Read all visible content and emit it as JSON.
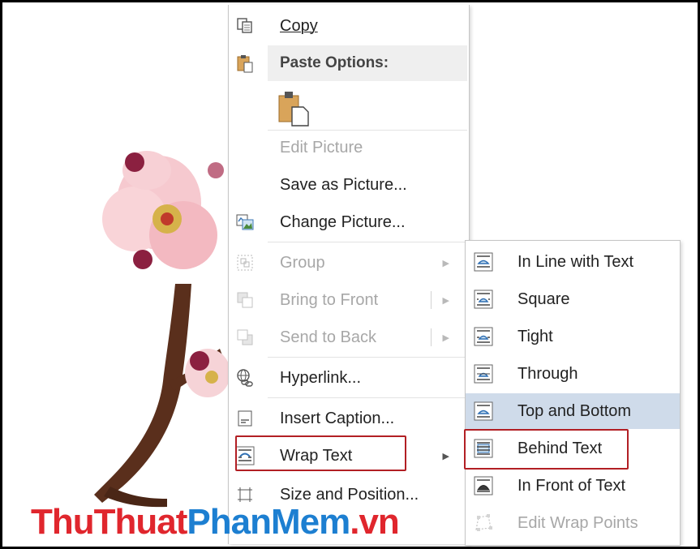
{
  "context_menu": {
    "items": [
      {
        "label": "Copy",
        "icon": "copy-icon",
        "enabled": true
      },
      {
        "label": "Paste Options:",
        "icon": "clipboard-icon",
        "enabled": true
      },
      {
        "label": "Edit Picture",
        "enabled": false
      },
      {
        "label": "Save as Picture...",
        "enabled": true
      },
      {
        "label": "Change Picture...",
        "icon": "change-picture-icon",
        "enabled": true
      },
      {
        "label": "Group",
        "icon": "group-icon",
        "enabled": false,
        "submenu": true
      },
      {
        "label": "Bring to Front",
        "icon": "bring-to-front-icon",
        "enabled": false,
        "submenu": true
      },
      {
        "label": "Send to Back",
        "icon": "send-to-back-icon",
        "enabled": false,
        "submenu": true
      },
      {
        "label": "Hyperlink...",
        "icon": "hyperlink-icon",
        "enabled": true
      },
      {
        "label": "Insert Caption...",
        "icon": "caption-icon",
        "enabled": true
      },
      {
        "label": "Wrap Text",
        "icon": "wrap-text-icon",
        "enabled": true,
        "submenu": true
      },
      {
        "label": "Size and Position...",
        "icon": "size-position-icon",
        "enabled": true
      }
    ],
    "paste_option_icon": "paste-keep-icon"
  },
  "wrap_submenu": {
    "items": [
      {
        "label": "In Line with Text",
        "enabled": true
      },
      {
        "label": "Square",
        "enabled": true
      },
      {
        "label": "Tight",
        "enabled": true
      },
      {
        "label": "Through",
        "enabled": true
      },
      {
        "label": "Top and Bottom",
        "enabled": true,
        "highlighted": true
      },
      {
        "label": "Behind Text",
        "enabled": true
      },
      {
        "label": "In Front of Text",
        "enabled": true
      },
      {
        "label": "Edit Wrap Points",
        "enabled": false
      }
    ]
  },
  "watermark": {
    "part1": "ThuThuat",
    "part2": "PhanMem",
    "part3": ".vn"
  },
  "colors": {
    "highlight": "#cfdbea",
    "annotation": "#b21f24"
  }
}
